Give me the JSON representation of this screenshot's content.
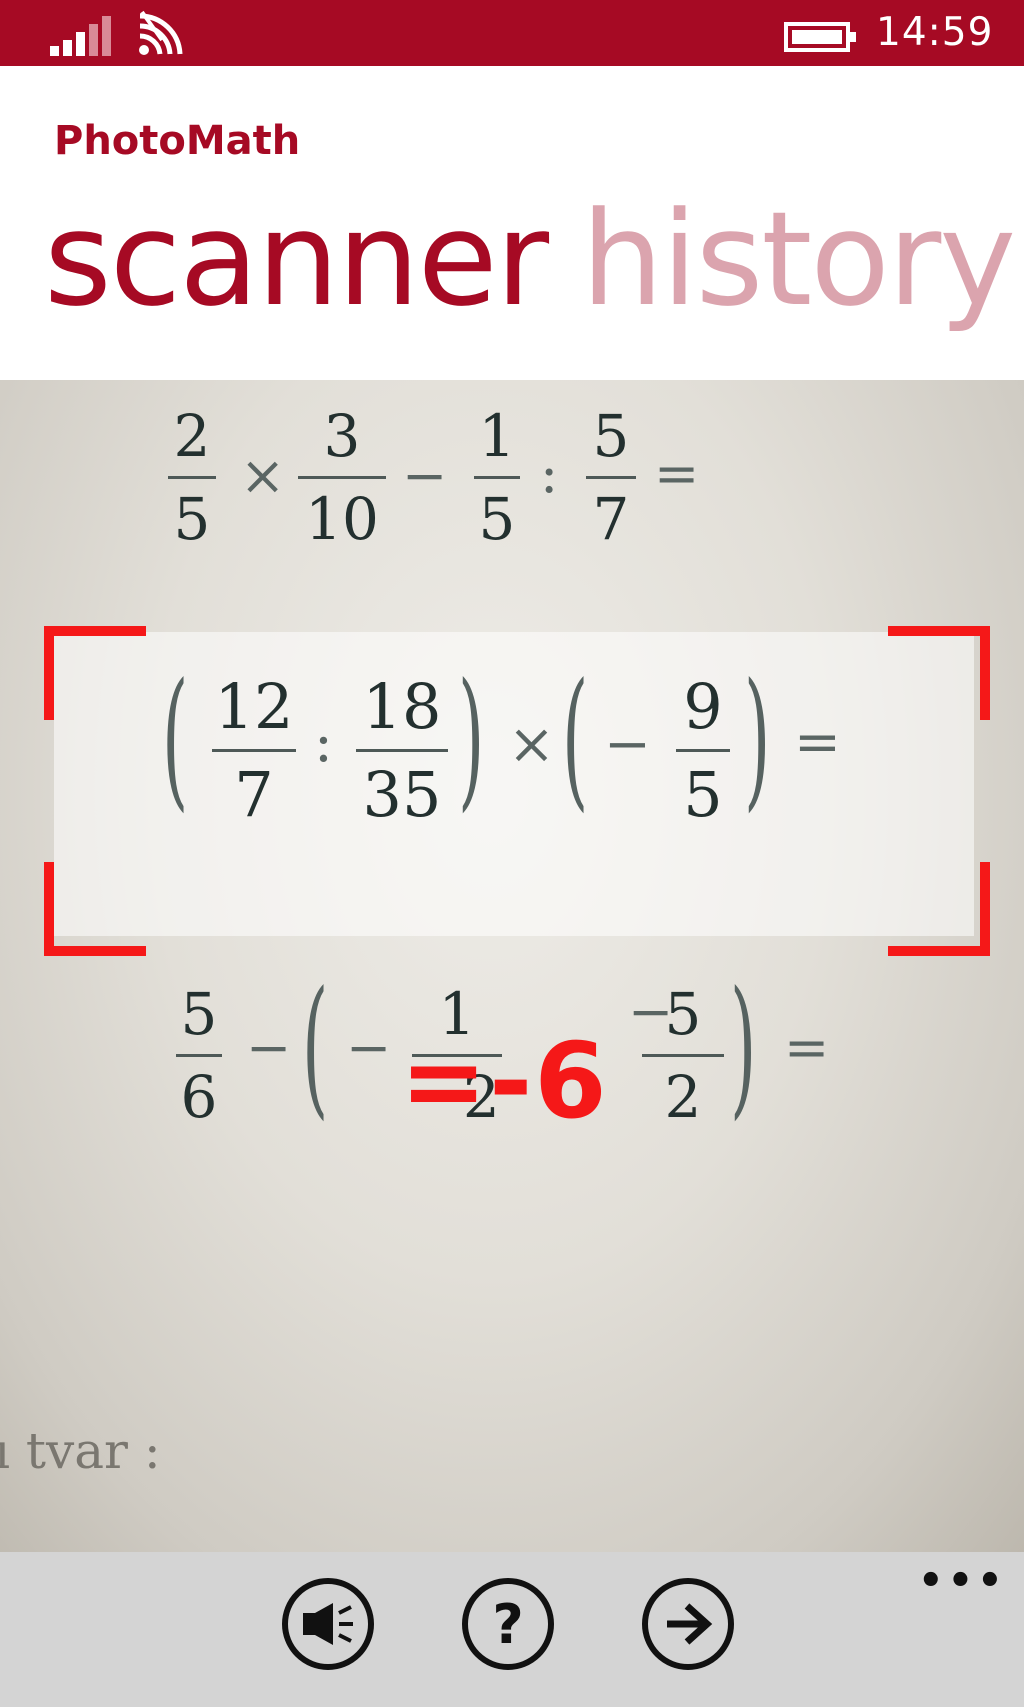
{
  "status_bar": {
    "time": "14:59",
    "icons": [
      "signal-icon",
      "wifi-icon",
      "battery-icon"
    ],
    "background": "#a60a24"
  },
  "header": {
    "app_title": "PhotoMath",
    "pivot_items": [
      {
        "label": "scanner",
        "active": true
      },
      {
        "label": "history",
        "active": false
      }
    ],
    "accent_color": "#a60a24"
  },
  "camera": {
    "expression_1": {
      "fractions": [
        {
          "num": "2",
          "den": "5"
        },
        {
          "num": "3",
          "den": "10"
        },
        {
          "num": "1",
          "den": "5"
        },
        {
          "num": "5",
          "den": "7"
        }
      ],
      "operators": [
        "×",
        "−",
        ":",
        "="
      ]
    },
    "expression_2": {
      "fractions": [
        {
          "num": "12",
          "den": "7"
        },
        {
          "num": "18",
          "den": "35"
        },
        {
          "num": "9",
          "den": "5"
        }
      ],
      "operators": [
        ":",
        "×",
        "−",
        "="
      ]
    },
    "expression_3": {
      "fractions": [
        {
          "num": "5",
          "den": "6"
        },
        {
          "num": "1",
          "den": "−2"
        },
        {
          "num": "5",
          "den": "2"
        }
      ],
      "operators": [
        "−",
        "−",
        "−",
        "="
      ]
    },
    "result": "=-6",
    "bottom_text": "ı tvar :",
    "frame_color": "#f51818"
  },
  "app_bar": {
    "buttons": [
      {
        "name": "flash-button",
        "icon": "flash-icon"
      },
      {
        "name": "help-button",
        "label": "?",
        "icon": "question-icon"
      },
      {
        "name": "next-button",
        "icon": "arrow-right-icon"
      }
    ],
    "more_label": "•••"
  }
}
